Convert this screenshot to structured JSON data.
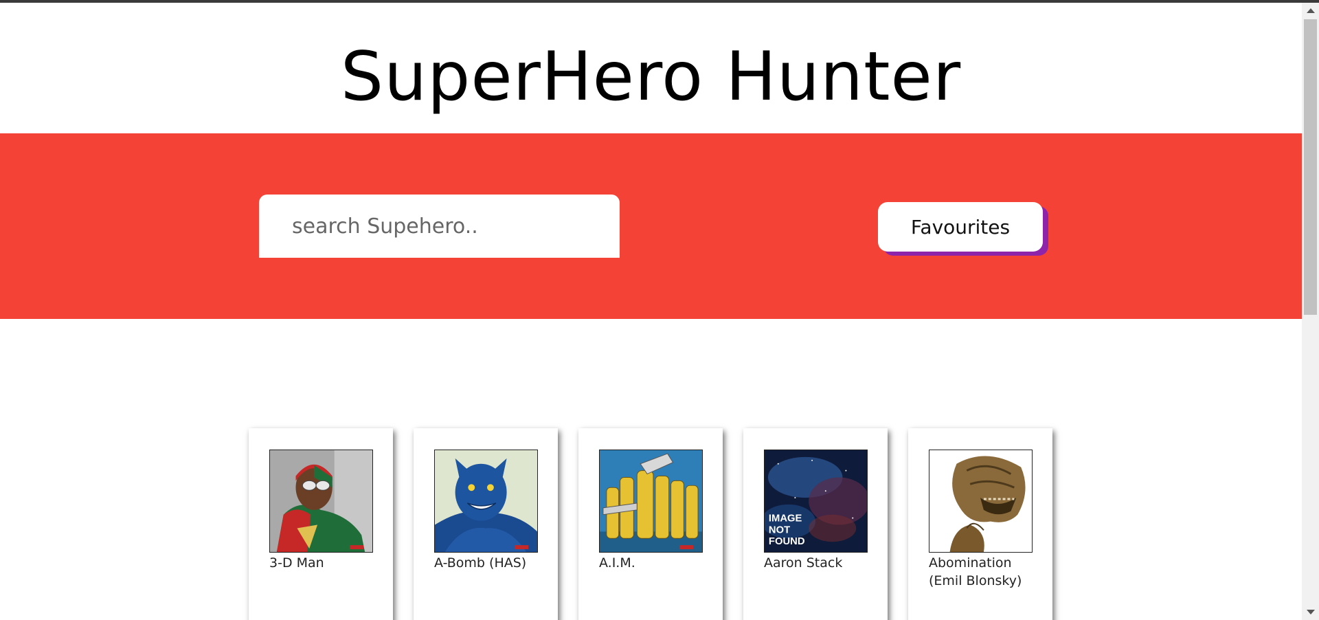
{
  "header": {
    "title": "SuperHero Hunter"
  },
  "search": {
    "placeholder": "search Supehero..",
    "value": ""
  },
  "favourites_button": {
    "label": "Favourites"
  },
  "colors": {
    "banner": "#f44336",
    "button_shadow": "#8e24aa"
  },
  "heroes": [
    {
      "name": "3-D Man",
      "image": "hero-portrait-3d-man"
    },
    {
      "name": "A-Bomb (HAS)",
      "image": "hero-portrait-a-bomb"
    },
    {
      "name": "A.I.M.",
      "image": "hero-portrait-aim"
    },
    {
      "name": "Aaron Stack",
      "image": "image-not-found",
      "image_text": [
        "IMAGE",
        "NOT",
        "FOUND"
      ]
    },
    {
      "name": "Abomination (Emil Blonsky)",
      "image": "hero-portrait-abomination"
    }
  ]
}
